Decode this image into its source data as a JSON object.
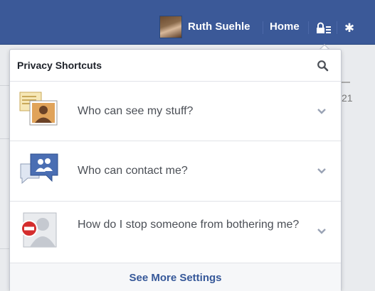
{
  "topbar": {
    "user_name": "Ruth Suehle",
    "home_label": "Home",
    "privacy_icon": "privacy-shortcuts-lock-icon",
    "settings_icon": "gear-icon",
    "bg_color": "#3b5998"
  },
  "background": {
    "right_number": "21"
  },
  "privacy_panel": {
    "title": "Privacy Shortcuts",
    "search_icon": "search-icon",
    "items": [
      {
        "label": "Who can see my stuff?",
        "icon": "photo-profile-icon"
      },
      {
        "label": "Who can contact me?",
        "icon": "chat-people-icon"
      },
      {
        "label": "How do I stop someone from bothering me?",
        "icon": "block-person-icon"
      }
    ],
    "footer_link": "See More Settings",
    "link_color": "#365899"
  }
}
